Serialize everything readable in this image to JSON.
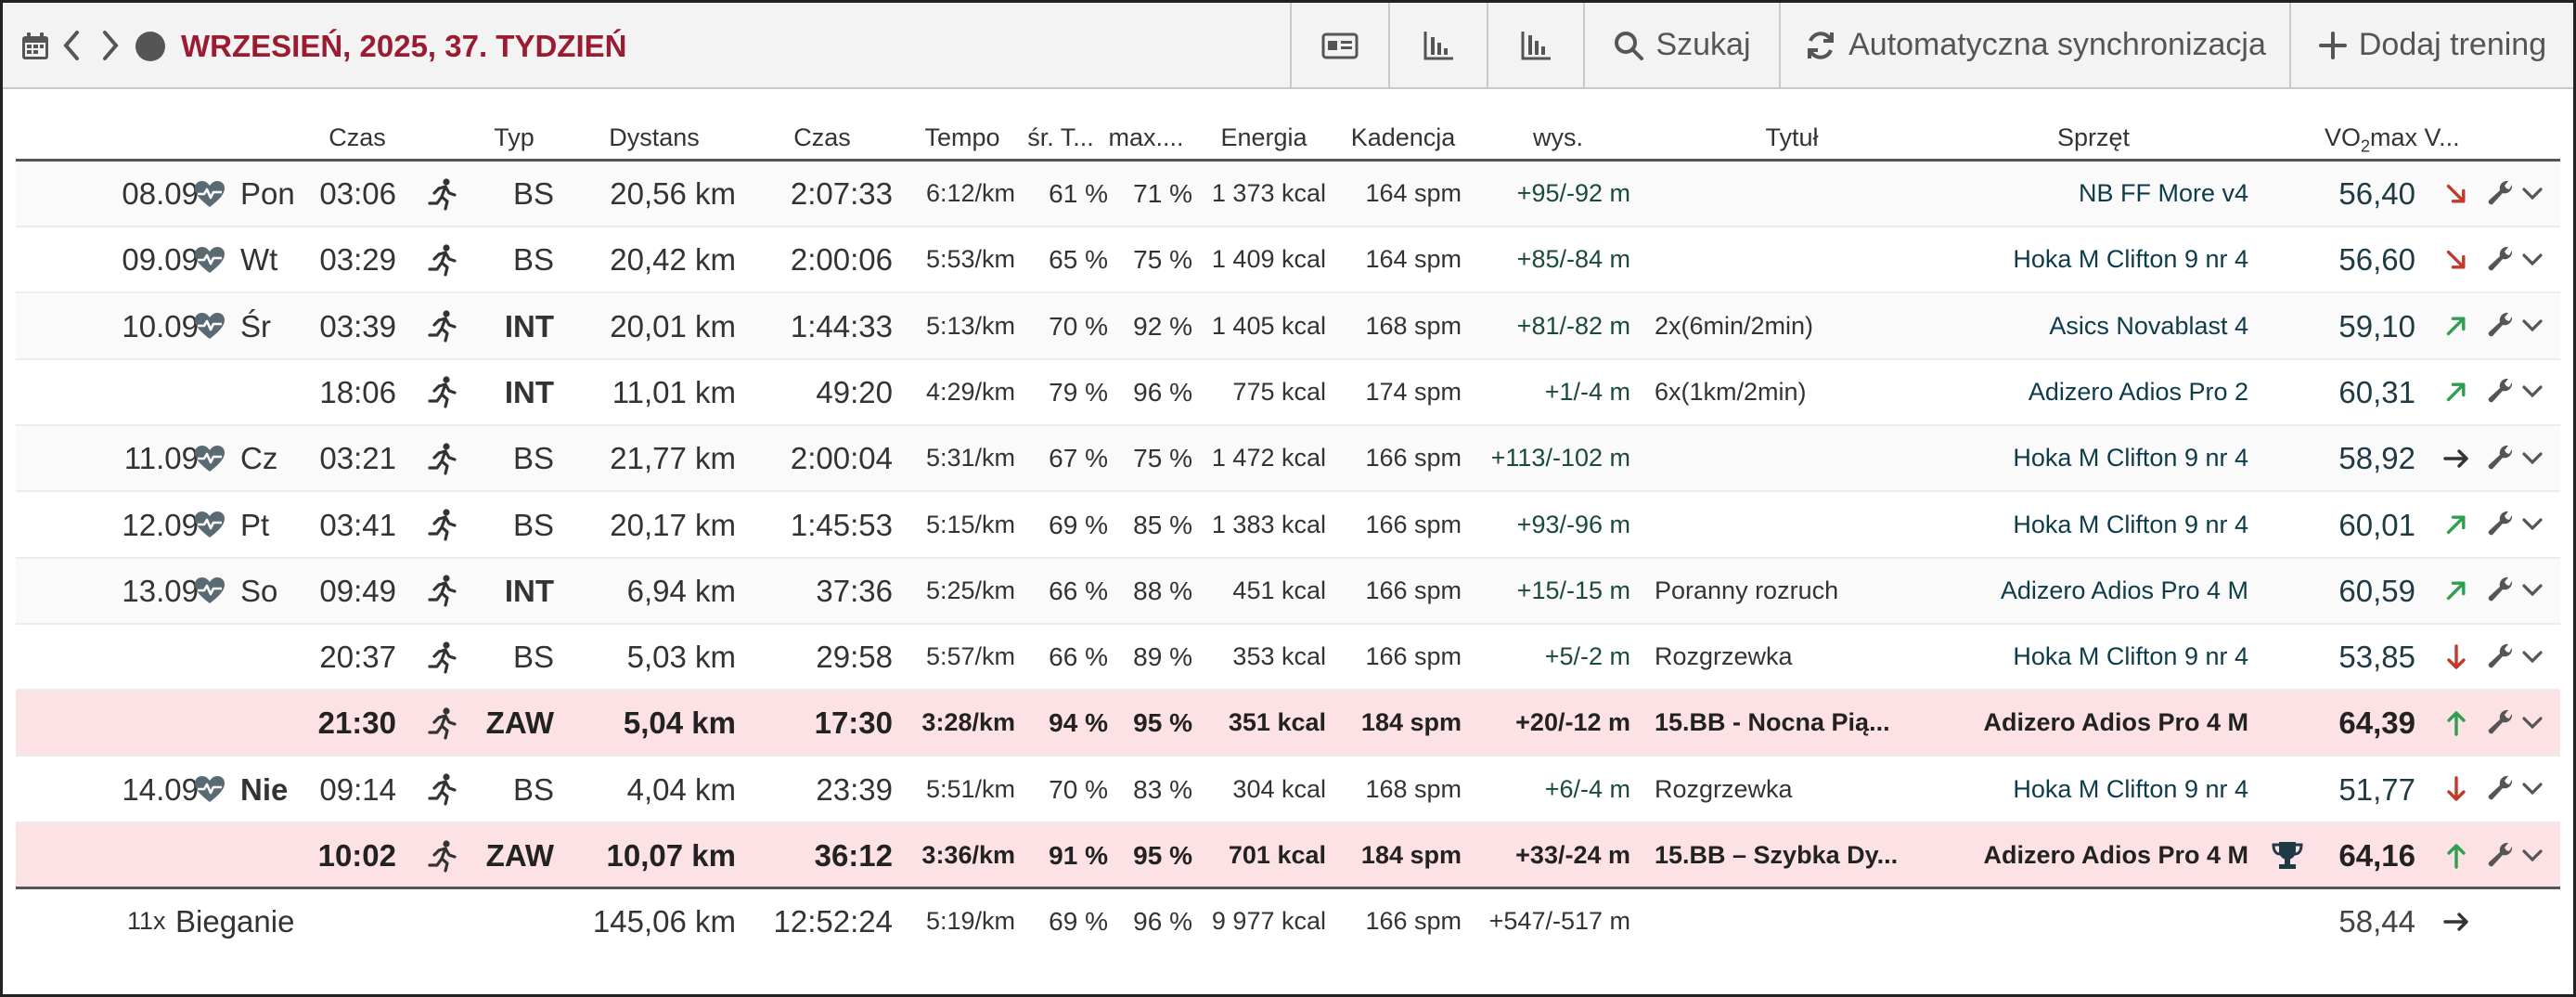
{
  "toolbar": {
    "title": "WRZESIEŃ, 2025, 37. TYDZIEŃ",
    "search_label": "Szukaj",
    "sync_label": "Automatyczna synchronizacja",
    "add_label": "Dodaj trening"
  },
  "columns": {
    "time_of_day": "Czas",
    "type": "Typ",
    "distance": "Dystans",
    "duration": "Czas",
    "pace": "Tempo",
    "avg_hr": "śr. T...",
    "max_hr": "max....",
    "energy": "Energia",
    "cadence": "Kadencja",
    "elevation": "wys.",
    "title": "Tytuł",
    "gear": "Sprzęt",
    "vo2_a": "VO",
    "vo2_sub": "2",
    "vo2_b": "max V..."
  },
  "rows": [
    {
      "date": "08.09",
      "day": "Pon",
      "time": "03:06",
      "type": "BS",
      "distance": "20,56 km",
      "duration": "2:07:33",
      "pace": "6:12/km",
      "avg_hr": "61 %",
      "max_hr": "71 %",
      "energy": "1 373 kcal",
      "cadence": "164 spm",
      "elevation": "+95/-92 m",
      "title": "",
      "gear": "NB FF More v4",
      "vo2": "56,40",
      "trend": "down-right",
      "highlight": false,
      "trophy": false
    },
    {
      "date": "09.09",
      "day": "Wt",
      "time": "03:29",
      "type": "BS",
      "distance": "20,42 km",
      "duration": "2:00:06",
      "pace": "5:53/km",
      "avg_hr": "65 %",
      "max_hr": "75 %",
      "energy": "1 409 kcal",
      "cadence": "164 spm",
      "elevation": "+85/-84 m",
      "title": "",
      "gear": "Hoka M Clifton 9 nr 4",
      "vo2": "56,60",
      "trend": "down-right",
      "highlight": false,
      "trophy": false
    },
    {
      "date": "10.09",
      "day": "Śr",
      "time": "03:39",
      "type": "INT",
      "distance": "20,01 km",
      "duration": "1:44:33",
      "pace": "5:13/km",
      "avg_hr": "70 %",
      "max_hr": "92 %",
      "energy": "1 405 kcal",
      "cadence": "168 spm",
      "elevation": "+81/-82 m",
      "title": "2x(6min/2min)",
      "gear": "Asics Novablast 4",
      "vo2": "59,10",
      "trend": "up-right",
      "highlight": false,
      "trophy": false
    },
    {
      "date": "",
      "day": "",
      "time": "18:06",
      "type": "INT",
      "distance": "11,01 km",
      "duration": "49:20",
      "pace": "4:29/km",
      "avg_hr": "79 %",
      "max_hr": "96 %",
      "energy": "775 kcal",
      "cadence": "174 spm",
      "elevation": "+1/-4 m",
      "title": "6x(1km/2min)",
      "gear": "Adizero Adios Pro 2",
      "vo2": "60,31",
      "trend": "up-right",
      "highlight": false,
      "trophy": false
    },
    {
      "date": "11.09",
      "day": "Cz",
      "time": "03:21",
      "type": "BS",
      "distance": "21,77 km",
      "duration": "2:00:04",
      "pace": "5:31/km",
      "avg_hr": "67 %",
      "max_hr": "75 %",
      "energy": "1 472 kcal",
      "cadence": "166 spm",
      "elevation": "+113/-102 m",
      "title": "",
      "gear": "Hoka M Clifton 9 nr 4",
      "vo2": "58,92",
      "trend": "right",
      "highlight": false,
      "trophy": false
    },
    {
      "date": "12.09",
      "day": "Pt",
      "time": "03:41",
      "type": "BS",
      "distance": "20,17 km",
      "duration": "1:45:53",
      "pace": "5:15/km",
      "avg_hr": "69 %",
      "max_hr": "85 %",
      "energy": "1 383 kcal",
      "cadence": "166 spm",
      "elevation": "+93/-96 m",
      "title": "",
      "gear": "Hoka M Clifton 9 nr 4",
      "vo2": "60,01",
      "trend": "up-right",
      "highlight": false,
      "trophy": false
    },
    {
      "date": "13.09",
      "day": "So",
      "time": "09:49",
      "type": "INT",
      "distance": "6,94 km",
      "duration": "37:36",
      "pace": "5:25/km",
      "avg_hr": "66 %",
      "max_hr": "88 %",
      "energy": "451 kcal",
      "cadence": "166 spm",
      "elevation": "+15/-15 m",
      "title": "Poranny rozruch",
      "gear": "Adizero Adios Pro 4 M",
      "vo2": "60,59",
      "trend": "up-right",
      "highlight": false,
      "trophy": false
    },
    {
      "date": "",
      "day": "",
      "time": "20:37",
      "type": "BS",
      "distance": "5,03 km",
      "duration": "29:58",
      "pace": "5:57/km",
      "avg_hr": "66 %",
      "max_hr": "89 %",
      "energy": "353 kcal",
      "cadence": "166 spm",
      "elevation": "+5/-2 m",
      "title": "Rozgrzewka",
      "gear": "Hoka M Clifton 9 nr 4",
      "vo2": "53,85",
      "trend": "down",
      "highlight": false,
      "trophy": false
    },
    {
      "date": "",
      "day": "",
      "time": "21:30",
      "type": "ZAW",
      "distance": "5,04 km",
      "duration": "17:30",
      "pace": "3:28/km",
      "avg_hr": "94 %",
      "max_hr": "95 %",
      "energy": "351 kcal",
      "cadence": "184 spm",
      "elevation": "+20/-12 m",
      "title": "15.BB - Nocna Pią...",
      "gear": "Adizero Adios Pro 4 M",
      "vo2": "64,39",
      "trend": "up",
      "highlight": true,
      "trophy": false
    },
    {
      "date": "14.09",
      "day": "Nie",
      "time": "09:14",
      "type": "BS",
      "distance": "4,04 km",
      "duration": "23:39",
      "pace": "5:51/km",
      "avg_hr": "70 %",
      "max_hr": "83 %",
      "energy": "304 kcal",
      "cadence": "168 spm",
      "elevation": "+6/-4 m",
      "title": "Rozgrzewka",
      "gear": "Hoka M Clifton 9 nr 4",
      "vo2": "51,77",
      "trend": "down",
      "highlight": false,
      "trophy": false,
      "bold_day": true
    },
    {
      "date": "",
      "day": "",
      "time": "10:02",
      "type": "ZAW",
      "distance": "10,07 km",
      "duration": "36:12",
      "pace": "3:36/km",
      "avg_hr": "91 %",
      "max_hr": "95 %",
      "energy": "701 kcal",
      "cadence": "184 spm",
      "elevation": "+33/-24 m",
      "title": "15.BB – Szybka Dy...",
      "gear": "Adizero Adios Pro 4 M",
      "vo2": "64,16",
      "trend": "up",
      "highlight": true,
      "trophy": true
    }
  ],
  "summary": {
    "count": "11x",
    "label": "Bieganie",
    "distance": "145,06 km",
    "duration": "12:52:24",
    "pace": "5:19/km",
    "avg_hr": "69 %",
    "max_hr": "96 %",
    "energy": "9 977 kcal",
    "cadence": "166 spm",
    "elevation": "+547/-517 m",
    "vo2": "58,44",
    "trend": "right"
  },
  "colors": {
    "title": "#9b1b30",
    "highlight_row": "#fde2e5",
    "trend_down": "#c0392b",
    "trend_up": "#2e9e4f",
    "trend_neutral": "#333333"
  }
}
